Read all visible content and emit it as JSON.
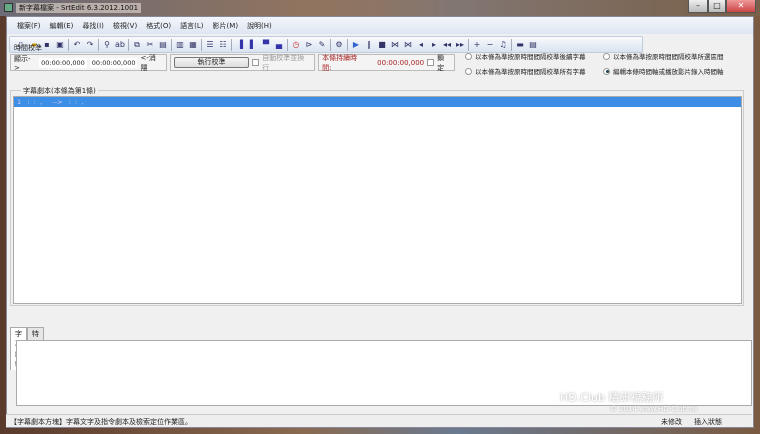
{
  "window": {
    "title": "新字幕檔案 - SrtEdit 6.3.2012.1001"
  },
  "menu": [
    "檔案(F)",
    "編輯(E)",
    "尋找(I)",
    "檢視(V)",
    "格式(O)",
    "語言(L)",
    "影片(M)",
    "說明(H)"
  ],
  "time_panel": {
    "label": "時間校準",
    "show_label": "顯示->",
    "start": "00:00:00,000",
    "end": "00:00:00,000",
    "hide_label": "<-消隱",
    "run_button": "執行校準",
    "auto_label": "自動校準並換行",
    "duration_label": "本條持續時間:",
    "duration": "00:00:00,000",
    "lock_label": "鎖定"
  },
  "radios": [
    {
      "label": "以本條為準按原時間間隔校準後續字幕",
      "selected": false
    },
    {
      "label": "以本條為準按原時間間隔校準所選區間",
      "selected": false
    },
    {
      "label": "以本條為準按原時間間隔校準所有字幕",
      "selected": false
    },
    {
      "label": "編輯本條時間軸或播放影片錄入時間軸",
      "selected": true
    }
  ],
  "script": {
    "label": "字幕劇本(本條為第1條)",
    "rows": [
      "1   :  :  ,     -->   :  :  ,"
    ]
  },
  "tabs": [
    {
      "label": "字幕編輯",
      "active": true
    },
    {
      "label": "特效預覽",
      "active": false
    }
  ],
  "status": {
    "text": "【字幕劇本方塊】字幕文字及指令劇本及檢索定位作業區。",
    "modified": "未修改",
    "mode": "插入狀態"
  },
  "watermark": {
    "brand": "HD.Club 精研視務所",
    "line2": "© 2014  www.HD-Club.tw"
  }
}
